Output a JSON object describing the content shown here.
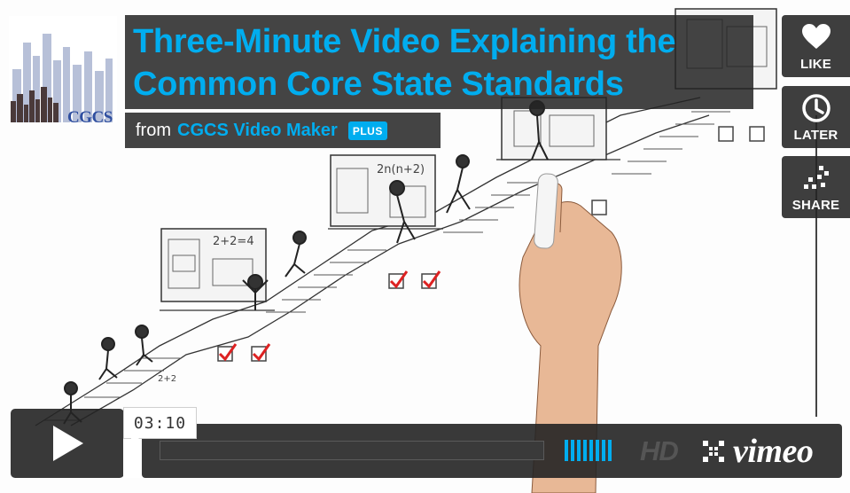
{
  "logo": {
    "text": "CGCS"
  },
  "video": {
    "title_line1": "Three-Minute Video Explaining the",
    "title_line2": "Common Core State Standards",
    "byline_from": "from",
    "byline_author": "CGCS Video Maker",
    "badge": "PLUS"
  },
  "side_buttons": {
    "like_label": "LIKE",
    "later_label": "LATER",
    "share_label": "SHARE"
  },
  "player": {
    "time": "03:10",
    "hd_label": "HD",
    "brand": "vimeo",
    "volume_bars": 8,
    "accent_color": "#00adef"
  },
  "illustration": {
    "board_math_1": "2+2=4",
    "board_math_2": "2n(n+2)",
    "stairs_math": "2+2"
  }
}
